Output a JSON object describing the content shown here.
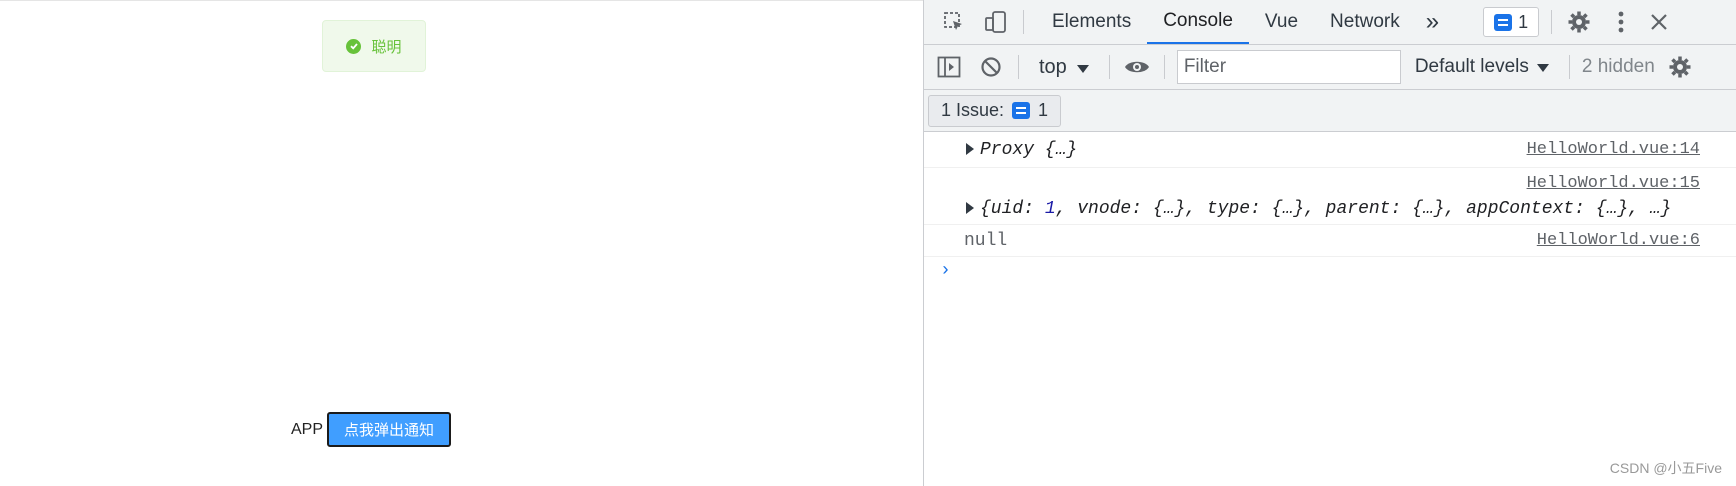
{
  "app": {
    "toast_text": "聪明",
    "label": "APP",
    "button_label": "点我弹出通知"
  },
  "devtools": {
    "tabs": [
      {
        "label": "Elements"
      },
      {
        "label": "Console"
      },
      {
        "label": "Vue"
      },
      {
        "label": "Network"
      }
    ],
    "more_tabs_glyph": "»",
    "issue_badge_count": "1",
    "toolbar": {
      "context": "top",
      "filter_placeholder": "Filter",
      "levels": "Default levels",
      "hidden": "2 hidden"
    },
    "issues_bar": {
      "label": "1 Issue:",
      "count": "1"
    },
    "logs": [
      {
        "text": "Proxy {…}",
        "source": "HelloWorld.vue:14"
      },
      {
        "source": "HelloWorld.vue:15",
        "parts": [
          "{uid: ",
          "1",
          ", vnode: {…}, type: {…}, parent: {…}, appContext: {…}, …}"
        ]
      },
      {
        "text": "null",
        "source": "HelloWorld.vue:6"
      }
    ],
    "prompt_glyph": "›"
  },
  "watermark": "CSDN @小五Five",
  "colors": {
    "toast_bg": "#f0f9eb",
    "toast_fg": "#67c23a",
    "button_bg": "#409eff",
    "tab_active": "#1a73e8"
  }
}
